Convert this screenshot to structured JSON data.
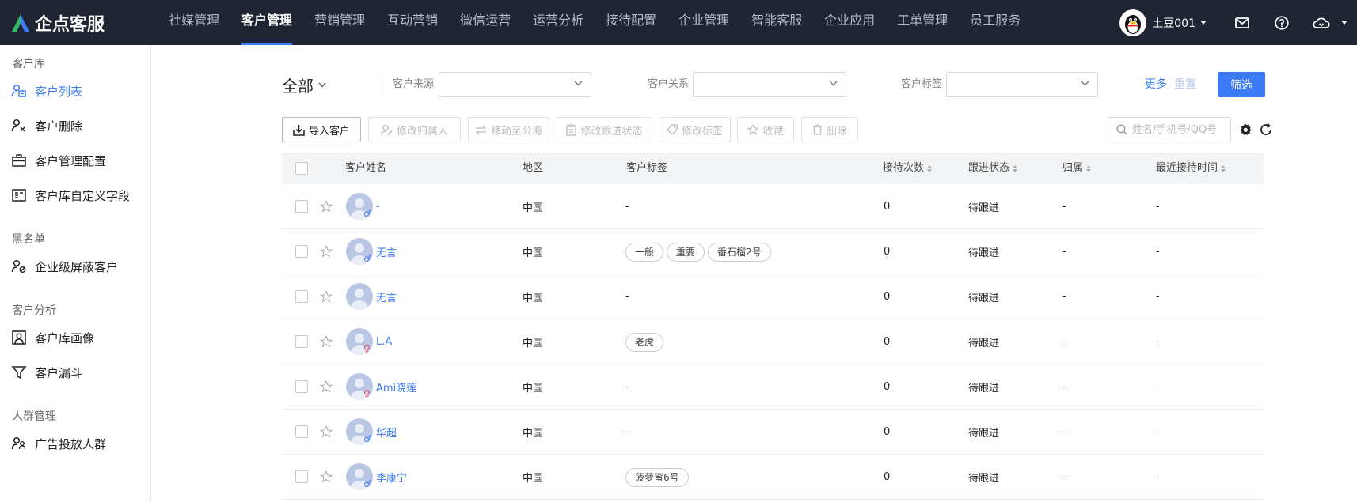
{
  "brand": {
    "name": "企点客服"
  },
  "nav": {
    "items": [
      {
        "label": "社媒管理"
      },
      {
        "label": "客户管理",
        "active": true
      },
      {
        "label": "营销管理"
      },
      {
        "label": "互动营销"
      },
      {
        "label": "微信运营"
      },
      {
        "label": "运营分析"
      },
      {
        "label": "接待配置"
      },
      {
        "label": "企业管理"
      },
      {
        "label": "智能客服"
      },
      {
        "label": "企业应用"
      },
      {
        "label": "工单管理"
      },
      {
        "label": "员工服务"
      }
    ]
  },
  "user": {
    "name": "土豆001"
  },
  "sidebar": {
    "groups": [
      {
        "title": "客户库",
        "items": [
          {
            "label": "客户列表",
            "active": true,
            "icon": "customer-list-icon"
          },
          {
            "label": "客户删除",
            "icon": "customer-delete-icon"
          },
          {
            "label": "客户管理配置",
            "icon": "briefcase-icon"
          },
          {
            "label": "客户库自定义字段",
            "icon": "custom-field-icon"
          }
        ]
      },
      {
        "title": "黑名单",
        "items": [
          {
            "label": "企业级屏蔽客户",
            "icon": "block-user-icon"
          }
        ]
      },
      {
        "title": "客户分析",
        "items": [
          {
            "label": "客户库画像",
            "icon": "portrait-icon"
          },
          {
            "label": "客户漏斗",
            "icon": "funnel-icon"
          }
        ]
      },
      {
        "title": "人群管理",
        "items": [
          {
            "label": "广告投放人群",
            "icon": "crowd-icon"
          }
        ]
      }
    ]
  },
  "filters": {
    "scope": "全部",
    "source_label": "客户来源",
    "relation_label": "客户关系",
    "tag_label": "客户标签",
    "more": "更多",
    "reset": "重置",
    "submit": "筛选"
  },
  "toolbar": {
    "import": "导入客户",
    "change_owner": "修改归属人",
    "move_to_pool": "移动至公海",
    "change_status": "修改跟进状态",
    "change_tags": "修改标签",
    "favorite": "收藏",
    "delete": "删除",
    "search_placeholder": "姓名/手机号/QQ号"
  },
  "table": {
    "columns": {
      "name": "客户姓名",
      "region": "地区",
      "tags": "客户标签",
      "visits": "接待次数",
      "status": "跟进状态",
      "owner": "归属",
      "last_time": "最近接待时间"
    },
    "rows": [
      {
        "name": "-",
        "gender": "♂",
        "region": "中国",
        "tags": [],
        "tags_empty": "-",
        "visits": "0",
        "status": "待跟进",
        "owner": "-",
        "last_time": "-"
      },
      {
        "name": "无言",
        "gender": "♂",
        "region": "中国",
        "tags": [
          "一般",
          "重要",
          "番石榴2号"
        ],
        "tags_empty": "",
        "visits": "0",
        "status": "待跟进",
        "owner": "-",
        "last_time": "-"
      },
      {
        "name": "无言",
        "gender": "",
        "region": "中国",
        "tags": [],
        "tags_empty": "-",
        "visits": "0",
        "status": "待跟进",
        "owner": "-",
        "last_time": "-"
      },
      {
        "name": "L.A",
        "gender": "♀",
        "region": "中国",
        "tags": [
          "老虎"
        ],
        "tags_empty": "",
        "visits": "0",
        "status": "待跟进",
        "owner": "-",
        "last_time": "-"
      },
      {
        "name": "Ami晓莲",
        "gender": "♀",
        "region": "中国",
        "tags": [],
        "tags_empty": "-",
        "visits": "0",
        "status": "待跟进",
        "owner": "-",
        "last_time": "-"
      },
      {
        "name": "华超",
        "gender": "♂",
        "region": "中国",
        "tags": [],
        "tags_empty": "-",
        "visits": "0",
        "status": "待跟进",
        "owner": "-",
        "last_time": "-"
      },
      {
        "name": "李康宁",
        "gender": "♂",
        "region": "中国",
        "tags": [
          "菠萝蜜6号"
        ],
        "tags_empty": "",
        "visits": "0",
        "status": "待跟进",
        "owner": "-",
        "last_time": "-"
      }
    ]
  }
}
